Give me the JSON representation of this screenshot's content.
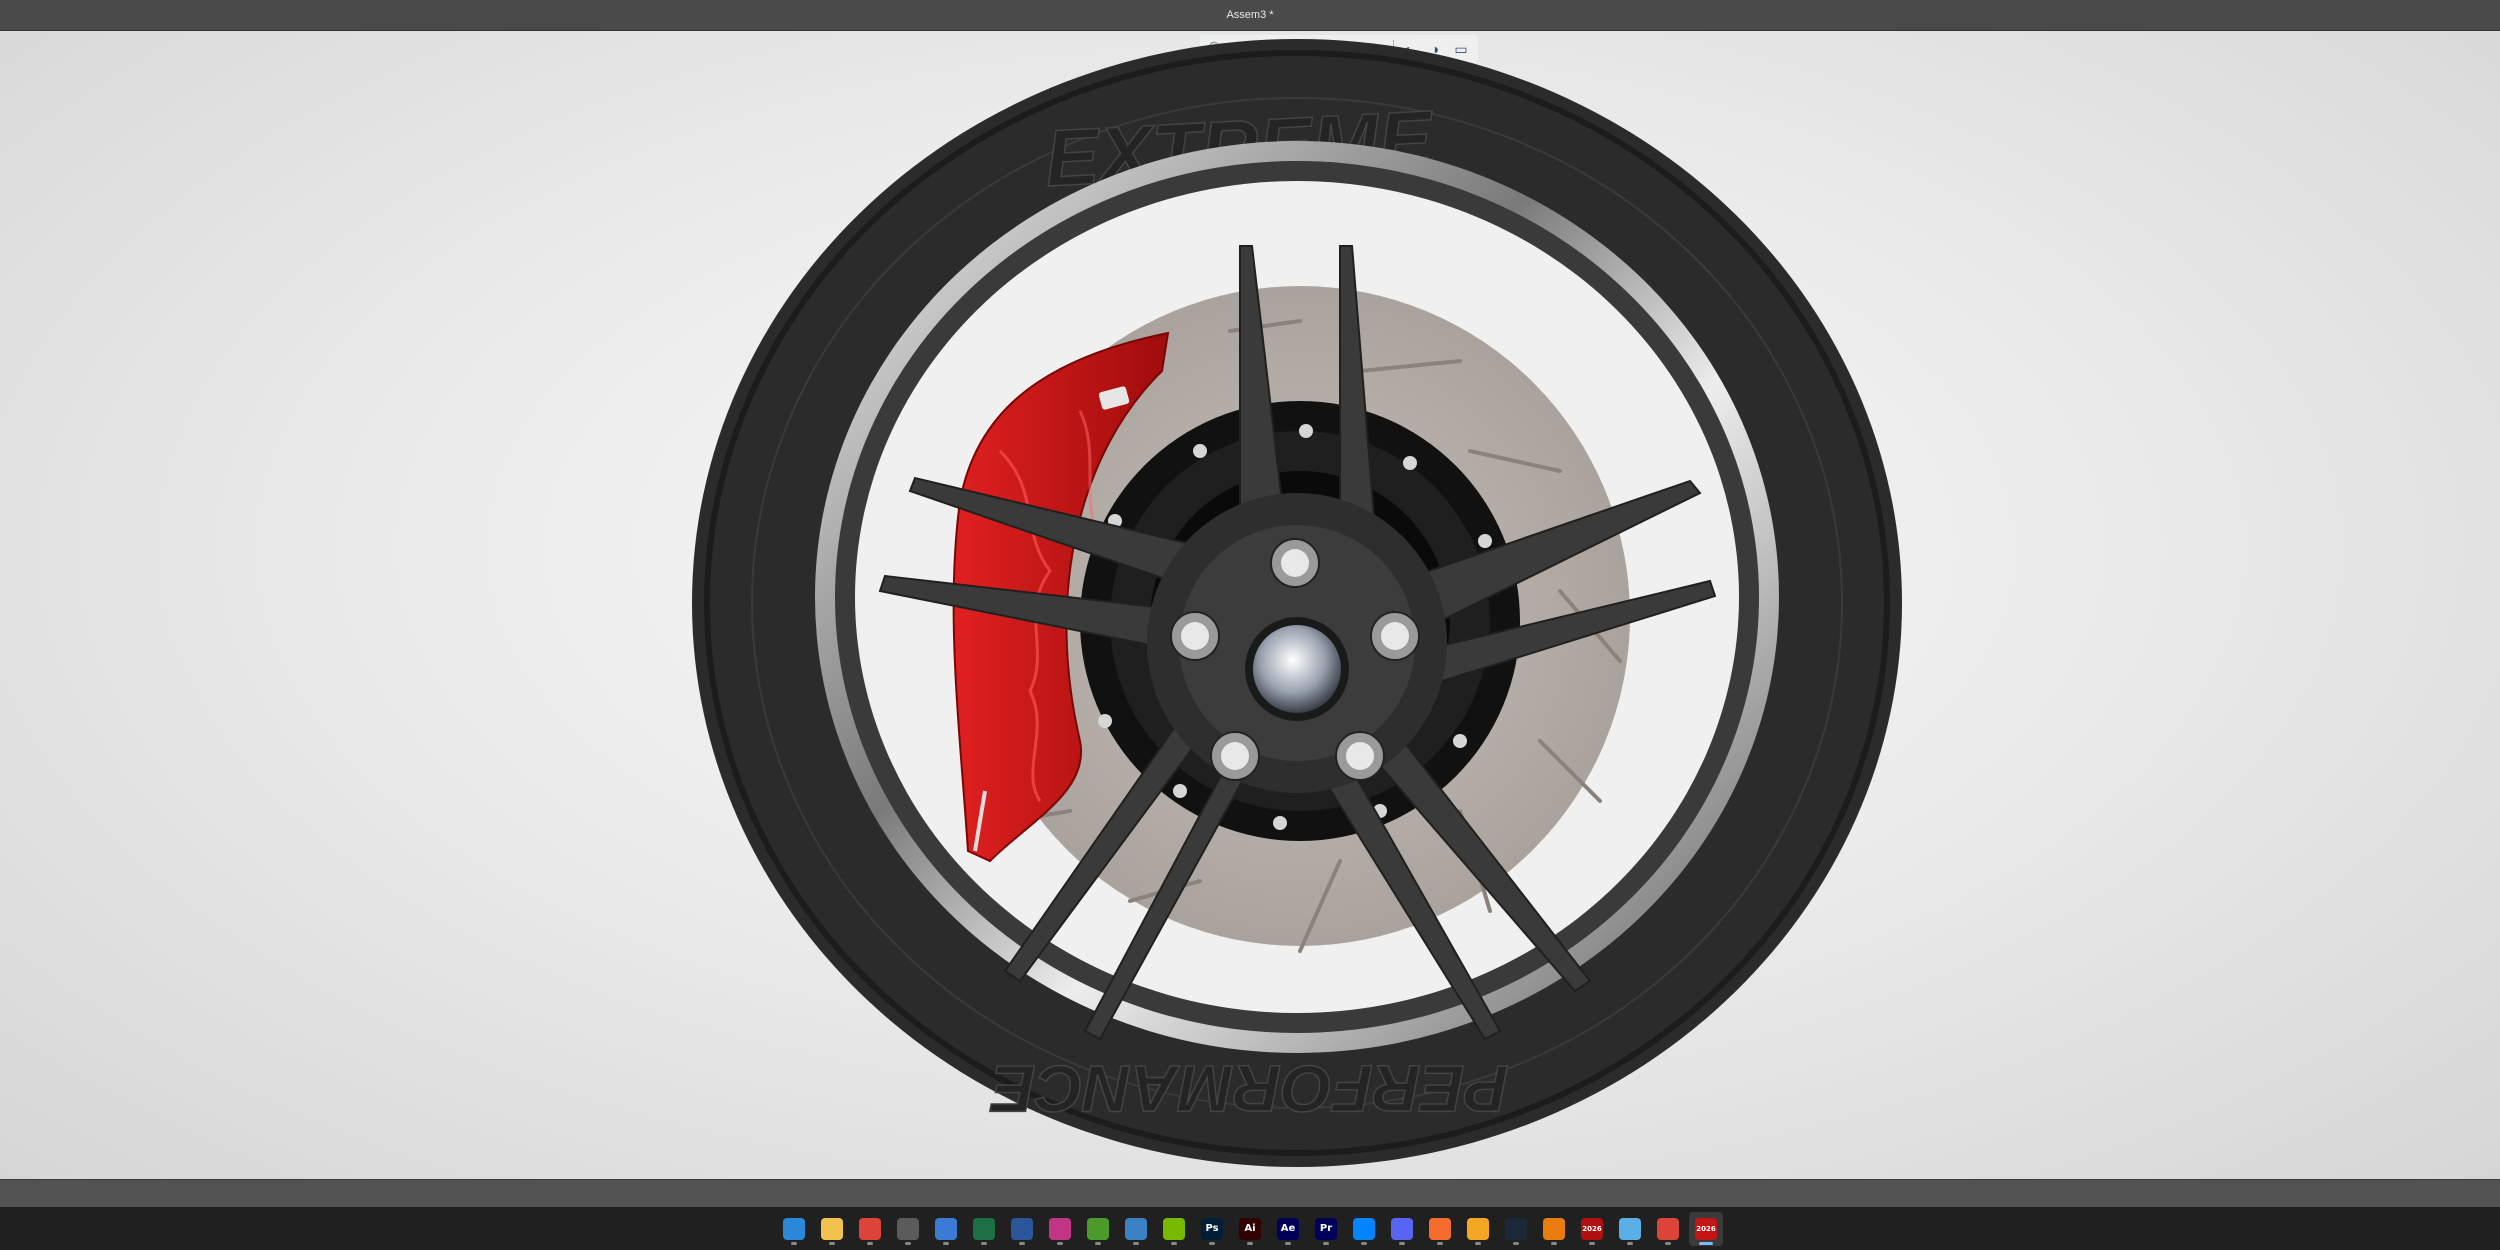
{
  "window": {
    "title": "Assem3 *"
  },
  "viewport": {
    "hud_icons": [
      "search-icon",
      "zoom-area-icon",
      "previous-view-icon",
      "section-view-icon",
      "view-orientation-icon",
      "display-style-icon",
      "hide-show-icon",
      "edit-appearance-icon",
      "scenes-icon",
      "view-settings-icon"
    ],
    "model": {
      "tire_sidewall_text_top": "EXTREME",
      "tire_sidewall_text_bottom": "PERFORMANCE",
      "caliper_color": "#cc1414",
      "tire_color": "#2b2b2b",
      "spoke_color": "#3a3a3a"
    }
  },
  "taskbar": {
    "items": [
      {
        "name": "start-icon",
        "label": "",
        "color": "#2b88d8",
        "active": false
      },
      {
        "name": "file-explorer-icon",
        "label": "",
        "color": "#f2c14e",
        "active": false
      },
      {
        "name": "chrome-icon",
        "label": "",
        "color": "#db4437",
        "active": false
      },
      {
        "name": "calculator-icon",
        "label": "",
        "color": "#5b5b5b",
        "active": false
      },
      {
        "name": "store-icon",
        "label": "",
        "color": "#3a7bd5",
        "active": false
      },
      {
        "name": "excel-icon",
        "label": "",
        "color": "#1d7044",
        "active": false
      },
      {
        "name": "word-icon",
        "label": "",
        "color": "#2b579a",
        "active": false
      },
      {
        "name": "instagram-icon",
        "label": "",
        "color": "#c13584",
        "active": false
      },
      {
        "name": "xbox-icon",
        "label": "",
        "color": "#4c9a2a",
        "active": false
      },
      {
        "name": "phone-link-icon",
        "label": "",
        "color": "#3b82c4",
        "active": false
      },
      {
        "name": "nvidia-icon",
        "label": "",
        "color": "#76b900",
        "active": false
      },
      {
        "name": "photoshop-icon",
        "label": "Ps",
        "color": "#001e36",
        "active": false
      },
      {
        "name": "illustrator-icon",
        "label": "Ai",
        "color": "#330000",
        "active": false
      },
      {
        "name": "after-effects-icon",
        "label": "Ae",
        "color": "#00005b",
        "active": false
      },
      {
        "name": "premiere-icon",
        "label": "Pr",
        "color": "#00005b",
        "active": false
      },
      {
        "name": "messenger-icon",
        "label": "",
        "color": "#0084ff",
        "active": false
      },
      {
        "name": "discord-icon",
        "label": "",
        "color": "#5865f2",
        "active": false
      },
      {
        "name": "origin-icon",
        "label": "",
        "color": "#f56c2d",
        "active": false
      },
      {
        "name": "fusion-icon",
        "label": "",
        "color": "#f5a623",
        "active": false
      },
      {
        "name": "steam-icon",
        "label": "",
        "color": "#1b2838",
        "active": false
      },
      {
        "name": "blender-icon",
        "label": "",
        "color": "#e87d0d",
        "active": false
      },
      {
        "name": "solidworks-2026-icon",
        "label": "2026",
        "color": "#b01010",
        "active": false
      },
      {
        "name": "3d-viewer-icon",
        "label": "",
        "color": "#5ab0e6",
        "active": false
      },
      {
        "name": "chrome-alt-icon",
        "label": "",
        "color": "#db4437",
        "active": false
      },
      {
        "name": "solidworks-2026-active-icon",
        "label": "2026",
        "color": "#c41414",
        "active": true
      }
    ]
  }
}
